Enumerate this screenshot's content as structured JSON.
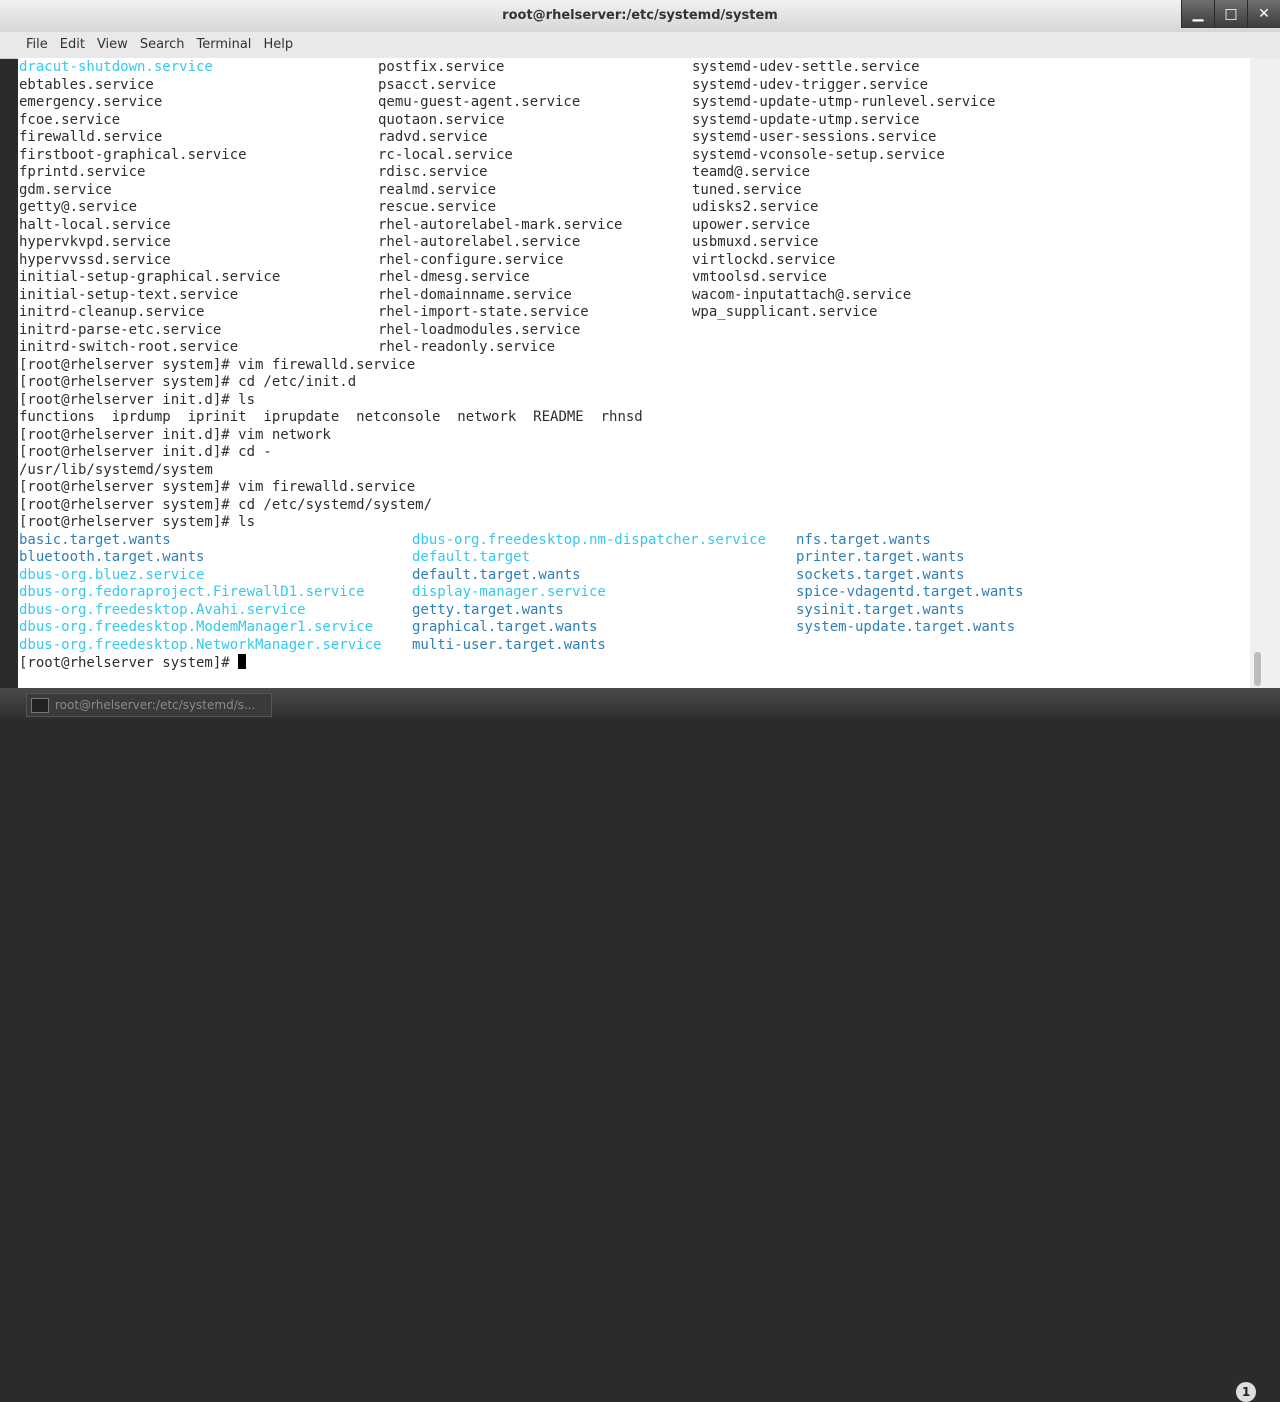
{
  "window": {
    "title": "root@rhelserver:/etc/systemd/system",
    "minimize_glyph": "▁",
    "maximize_glyph": "□",
    "close_glyph": "✕"
  },
  "menu": [
    "File",
    "Edit",
    "View",
    "Search",
    "Terminal",
    "Help"
  ],
  "terminal": {
    "top_listing": [
      [
        "dracut-shutdown.service",
        "postfix.service",
        "systemd-udev-settle.service"
      ],
      [
        "ebtables.service",
        "psacct.service",
        "systemd-udev-trigger.service"
      ],
      [
        "emergency.service",
        "qemu-guest-agent.service",
        "systemd-update-utmp-runlevel.service"
      ],
      [
        "fcoe.service",
        "quotaon.service",
        "systemd-update-utmp.service"
      ],
      [
        "firewalld.service",
        "radvd.service",
        "systemd-user-sessions.service"
      ],
      [
        "firstboot-graphical.service",
        "rc-local.service",
        "systemd-vconsole-setup.service"
      ],
      [
        "fprintd.service",
        "rdisc.service",
        "teamd@.service"
      ],
      [
        "gdm.service",
        "realmd.service",
        "tuned.service"
      ],
      [
        "getty@.service",
        "rescue.service",
        "udisks2.service"
      ],
      [
        "halt-local.service",
        "rhel-autorelabel-mark.service",
        "upower.service"
      ],
      [
        "hypervkvpd.service",
        "rhel-autorelabel.service",
        "usbmuxd.service"
      ],
      [
        "hypervvssd.service",
        "rhel-configure.service",
        "virtlockd.service"
      ],
      [
        "initial-setup-graphical.service",
        "rhel-dmesg.service",
        "vmtoolsd.service"
      ],
      [
        "initial-setup-text.service",
        "rhel-domainname.service",
        "wacom-inputattach@.service"
      ],
      [
        "initrd-cleanup.service",
        "rhel-import-state.service",
        "wpa_supplicant.service"
      ],
      [
        "initrd-parse-etc.service",
        "rhel-loadmodules.service",
        ""
      ],
      [
        "initrd-switch-root.service",
        "rhel-readonly.service",
        ""
      ]
    ],
    "history": [
      "[root@rhelserver system]# vim firewalld.service",
      "[root@rhelserver system]# cd /etc/init.d",
      "[root@rhelserver init.d]# ls",
      "functions  iprdump  iprinit  iprupdate  netconsole  network  README  rhnsd",
      "[root@rhelserver init.d]# vim network",
      "[root@rhelserver init.d]# cd -",
      "/usr/lib/systemd/system",
      "[root@rhelserver system]# vim firewalld.service",
      "[root@rhelserver system]# cd /etc/systemd/system/",
      "[root@rhelserver system]# ls"
    ],
    "bottom_listing": [
      [
        "basic.target.wants",
        "dbus-org.freedesktop.nm-dispatcher.service",
        "nfs.target.wants"
      ],
      [
        "bluetooth.target.wants",
        "default.target",
        "printer.target.wants"
      ],
      [
        "dbus-org.bluez.service",
        "default.target.wants",
        "sockets.target.wants"
      ],
      [
        "dbus-org.fedoraproject.FirewallD1.service",
        "display-manager.service",
        "spice-vdagentd.target.wants"
      ],
      [
        "dbus-org.freedesktop.Avahi.service",
        "getty.target.wants",
        "sysinit.target.wants"
      ],
      [
        "dbus-org.freedesktop.ModemManager1.service",
        "graphical.target.wants",
        "system-update.target.wants"
      ],
      [
        "dbus-org.freedesktop.NetworkManager.service",
        "multi-user.target.wants",
        ""
      ]
    ],
    "bottom_listing_links": [
      [
        false,
        true,
        false
      ],
      [
        false,
        true,
        false
      ],
      [
        true,
        false,
        false
      ],
      [
        true,
        true,
        false
      ],
      [
        true,
        false,
        false
      ],
      [
        true,
        false,
        false
      ],
      [
        true,
        false,
        false
      ]
    ],
    "prompt": "[root@rhelserver system]# "
  },
  "taskbar": {
    "task_label": "root@rhelserver:/etc/systemd/s...",
    "workspace": "1"
  },
  "colors": {
    "link_cyan": "#35c9ee",
    "dir_blue": "#2e7fb8",
    "text": "#2e2e2e"
  }
}
